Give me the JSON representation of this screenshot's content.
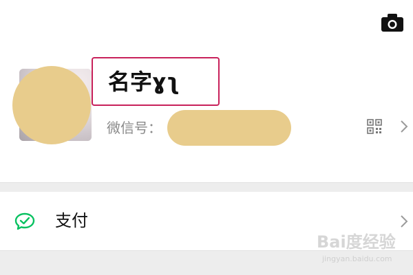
{
  "header": {
    "camera_icon": "camera-icon"
  },
  "profile": {
    "name": "名字ɣʅ",
    "wechat_id_label": "微信号：",
    "wechat_id_value_masked": true,
    "avatar_masked": true,
    "qr_icon": "qr-code-icon",
    "chevron_icon": "chevron-right-icon"
  },
  "menu": {
    "items": [
      {
        "label": "支付",
        "icon": "pay-icon",
        "icon_color": "#07c160"
      }
    ]
  },
  "watermark": {
    "brand": "Bai度经验",
    "url": "jingyan.baidu.com"
  },
  "colors": {
    "highlight_border": "#c8205a",
    "mask_color": "#e8cc8c",
    "divider": "#ededed",
    "pay_green": "#07c160",
    "muted_text": "#8a8a8a"
  }
}
